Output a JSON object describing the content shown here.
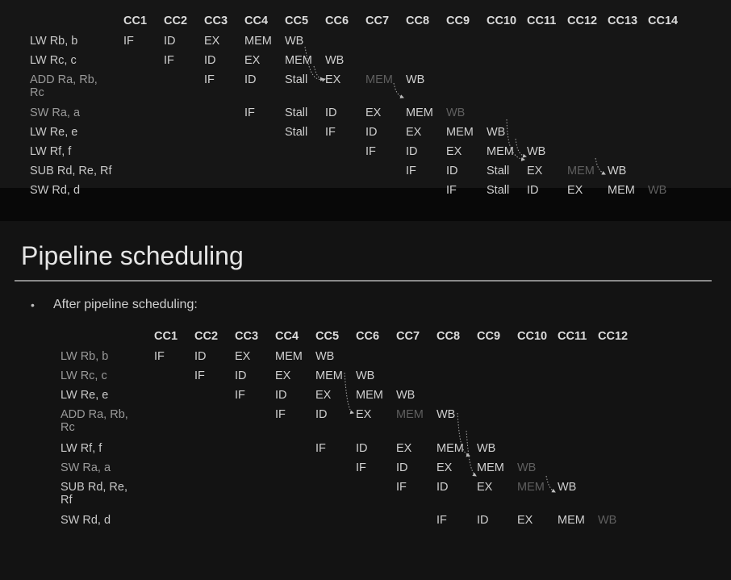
{
  "top_table": {
    "headers": [
      "CC1",
      "CC2",
      "CC3",
      "CC4",
      "CC5",
      "CC6",
      "CC7",
      "CC8",
      "CC9",
      "CC10",
      "CC11",
      "CC12",
      "CC13",
      "CC14"
    ],
    "rows": [
      {
        "label": "LW Rb, b",
        "cells": [
          [
            "IF",
            0
          ],
          [
            "ID",
            1
          ],
          [
            "EX",
            2
          ],
          [
            "MEM",
            3
          ],
          [
            "WB",
            4
          ]
        ]
      },
      {
        "label": "LW Rc, c",
        "cells": [
          [
            "IF",
            1
          ],
          [
            "ID",
            2
          ],
          [
            "EX",
            3
          ],
          [
            "MEM",
            4
          ],
          [
            "WB",
            5
          ]
        ]
      },
      {
        "label": "ADD Ra, Rb, Rc",
        "cells": [
          [
            "IF",
            2
          ],
          [
            "ID",
            3
          ],
          [
            "Stall",
            4
          ],
          [
            "EX",
            5
          ],
          [
            "MEM",
            6,
            "faint"
          ],
          [
            "WB",
            7
          ]
        ]
      },
      {
        "label": "SW Ra, a",
        "cells": [
          [
            "IF",
            3
          ],
          [
            "Stall",
            4
          ],
          [
            "ID",
            5
          ],
          [
            "EX",
            6
          ],
          [
            "MEM",
            7
          ],
          [
            "WB",
            8,
            "faint"
          ]
        ]
      },
      {
        "label": "LW Re, e",
        "cells": [
          [
            "Stall",
            4
          ],
          [
            "IF",
            5
          ],
          [
            "ID",
            6
          ],
          [
            "EX",
            7
          ],
          [
            "MEM",
            8
          ],
          [
            "WB",
            9
          ]
        ]
      },
      {
        "label": "LW Rf, f",
        "cells": [
          [
            "IF",
            6
          ],
          [
            "ID",
            7
          ],
          [
            "EX",
            8
          ],
          [
            "MEM",
            9
          ],
          [
            "WB",
            10
          ]
        ]
      },
      {
        "label": "SUB Rd, Re, Rf",
        "cells": [
          [
            "IF",
            7
          ],
          [
            "ID",
            8
          ],
          [
            "Stall",
            9
          ],
          [
            "EX",
            10
          ],
          [
            "MEM",
            11,
            "faint"
          ],
          [
            "WB",
            12
          ]
        ]
      },
      {
        "label": "SW Rd, d",
        "cells": [
          [
            "IF",
            8
          ],
          [
            "Stall",
            9
          ],
          [
            "ID",
            10
          ],
          [
            "EX",
            11
          ],
          [
            "MEM",
            12
          ],
          [
            "WB",
            13,
            "faint"
          ]
        ]
      }
    ]
  },
  "slide": {
    "title": "Pipeline scheduling",
    "bullet_marker": "•",
    "bullet": "After pipeline scheduling:"
  },
  "bottom_table": {
    "headers": [
      "CC1",
      "CC2",
      "CC3",
      "CC4",
      "CC5",
      "CC6",
      "CC7",
      "CC8",
      "CC9",
      "CC10",
      "CC11",
      "CC12"
    ],
    "rows": [
      {
        "label": "LW Rb, b",
        "cells": [
          [
            "IF",
            0
          ],
          [
            "ID",
            1
          ],
          [
            "EX",
            2
          ],
          [
            "MEM",
            3
          ],
          [
            "WB",
            4
          ]
        ]
      },
      {
        "label": "LW Rc, c",
        "cells": [
          [
            "IF",
            1
          ],
          [
            "ID",
            2
          ],
          [
            "EX",
            3
          ],
          [
            "MEM",
            4
          ],
          [
            "WB",
            5
          ]
        ]
      },
      {
        "label": "LW Re, e",
        "cells": [
          [
            "IF",
            2
          ],
          [
            "ID",
            3
          ],
          [
            "EX",
            4
          ],
          [
            "MEM",
            5
          ],
          [
            "WB",
            6
          ]
        ]
      },
      {
        "label": "ADD Ra, Rb, Rc",
        "cells": [
          [
            "IF",
            3
          ],
          [
            "ID",
            4
          ],
          [
            "EX",
            5
          ],
          [
            "MEM",
            6,
            "faint"
          ],
          [
            "WB",
            7
          ]
        ]
      },
      {
        "label": "LW Rf, f",
        "cells": [
          [
            "IF",
            4
          ],
          [
            "ID",
            5
          ],
          [
            "EX",
            6
          ],
          [
            "MEM",
            7
          ],
          [
            "WB",
            8
          ]
        ]
      },
      {
        "label": "SW Ra, a",
        "cells": [
          [
            "IF",
            5
          ],
          [
            "ID",
            6
          ],
          [
            "EX",
            7
          ],
          [
            "MEM",
            8
          ],
          [
            "WB",
            9,
            "faint"
          ]
        ]
      },
      {
        "label": "SUB Rd, Re, Rf",
        "cells": [
          [
            "IF",
            6
          ],
          [
            "ID",
            7
          ],
          [
            "EX",
            8
          ],
          [
            "MEM",
            9,
            "faint"
          ],
          [
            "WB",
            10
          ]
        ]
      },
      {
        "label": "SW Rd, d",
        "cells": [
          [
            "IF",
            7
          ],
          [
            "ID",
            8
          ],
          [
            "EX",
            9
          ],
          [
            "MEM",
            10
          ],
          [
            "WB",
            11,
            "faint"
          ]
        ]
      }
    ]
  },
  "colors": {
    "background": "#121212",
    "text": "#d0d0d0",
    "faint": "#5f5f5f",
    "rule": "#8a8a8a"
  }
}
